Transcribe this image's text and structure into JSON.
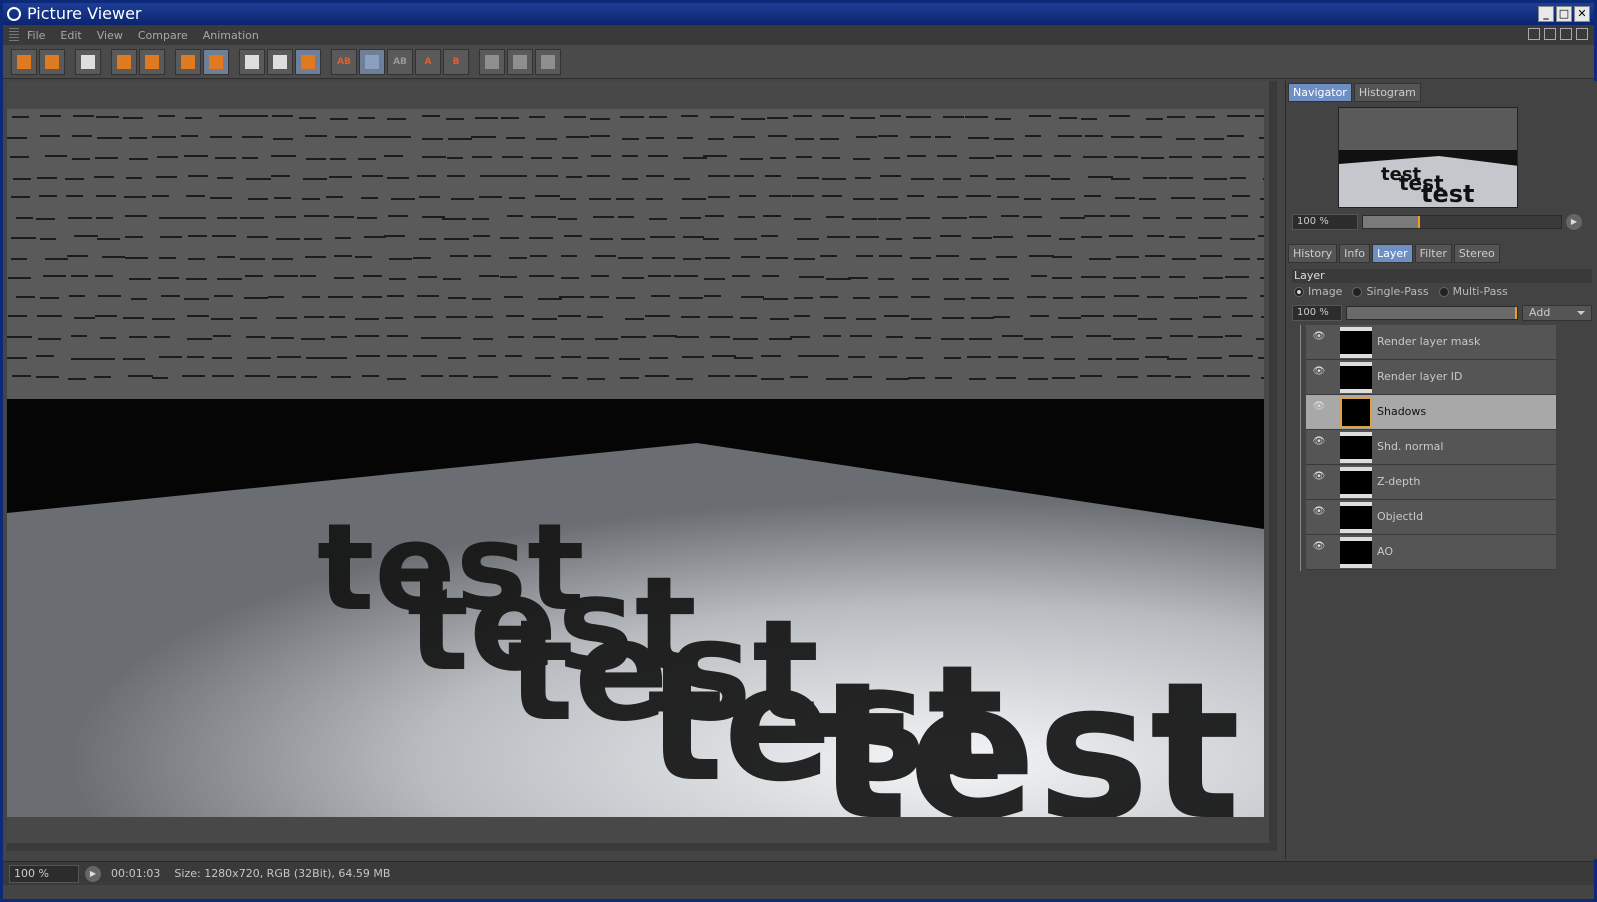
{
  "window": {
    "title": "Picture Viewer"
  },
  "menu": {
    "items": [
      "File",
      "Edit",
      "View",
      "Compare",
      "Animation"
    ]
  },
  "toolbar": {
    "ab_label": "AB",
    "a_label": "A",
    "b_label": "B"
  },
  "status": {
    "zoom": "100 %",
    "time": "00:01:03",
    "info": "Size: 1280x720, RGB (32Bit), 64.59 MB"
  },
  "navigator": {
    "tabs": [
      "Navigator",
      "Histogram"
    ],
    "active_tab": "Navigator",
    "zoom": "100 %",
    "zoom_level_fraction": 0.28
  },
  "panel": {
    "tabs": [
      "History",
      "Info",
      "Layer",
      "Filter",
      "Stereo"
    ],
    "active_tab": "Layer"
  },
  "layer": {
    "header": "Layer",
    "modes": [
      "Image",
      "Single-Pass",
      "Multi-Pass"
    ],
    "selected_mode": "Image",
    "zoom": "100 %",
    "add_label": "Add",
    "items": [
      {
        "name": "Render layer mask",
        "selected": false
      },
      {
        "name": "Render layer ID",
        "selected": false
      },
      {
        "name": "Shadows",
        "selected": true
      },
      {
        "name": "Shd. normal",
        "selected": false
      },
      {
        "name": "Z-depth",
        "selected": false
      },
      {
        "name": "ObjectId",
        "selected": false
      },
      {
        "name": "AO",
        "selected": false
      }
    ]
  },
  "render": {
    "text": "test",
    "colors": {
      "wall": "#5a5a5a",
      "floor_light": "#c8ccd0",
      "shadow": "#101010"
    }
  }
}
